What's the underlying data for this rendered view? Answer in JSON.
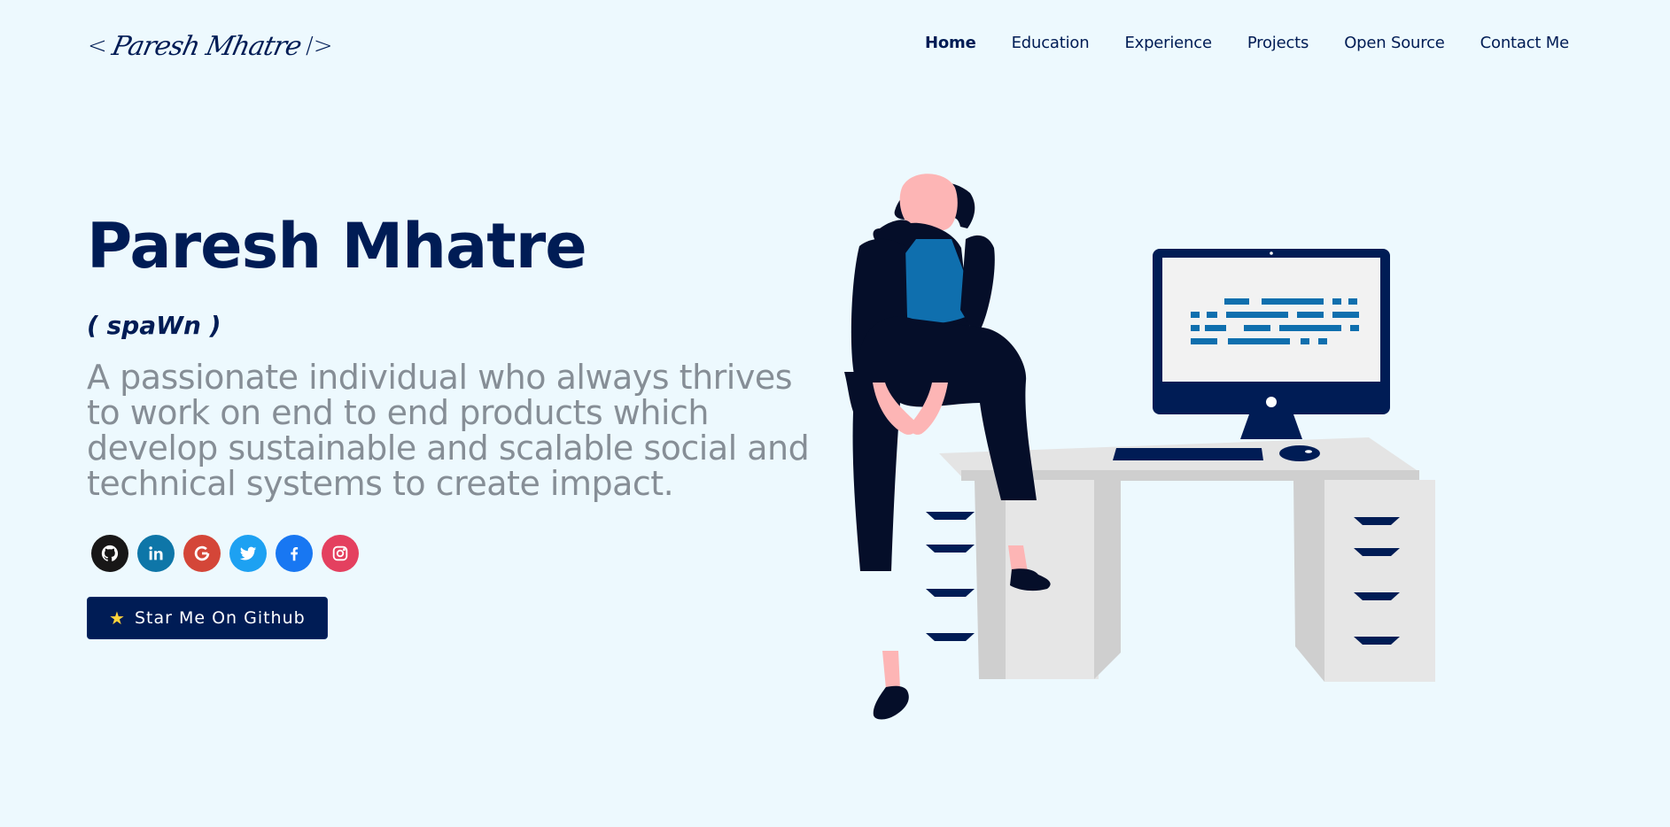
{
  "header": {
    "logo": {
      "open": "<",
      "name": "Paresh Mhatre",
      "close": "/>"
    },
    "nav": [
      "Home",
      "Education",
      "Experience",
      "Projects",
      "Open Source",
      "Contact Me"
    ],
    "active_nav": "Home"
  },
  "hero": {
    "name": "Paresh Mhatre",
    "alias": "( spaWn )",
    "description": "A passionate individual who always thrives to work on end to end products which develop sustainable and scalable social and technical systems to create impact.",
    "socials": [
      {
        "name": "github",
        "icon": "github-icon",
        "color": "#181717"
      },
      {
        "name": "linkedin",
        "icon": "linkedin-icon",
        "color": "#0E76A8"
      },
      {
        "name": "google",
        "icon": "google-icon",
        "color": "#D44638"
      },
      {
        "name": "twitter",
        "icon": "twitter-icon",
        "color": "#1DA1F2"
      },
      {
        "name": "facebook",
        "icon": "facebook-icon",
        "color": "#1877F2"
      },
      {
        "name": "instagram",
        "icon": "instagram-icon",
        "color": "#E4405F"
      }
    ],
    "cta": {
      "icon": "star-icon",
      "label": "Star Me On Github"
    }
  },
  "colors": {
    "background": "#EDF9FE",
    "primary": "#001C55",
    "description": "#868E96",
    "accent_blue": "#0F6FAE"
  }
}
